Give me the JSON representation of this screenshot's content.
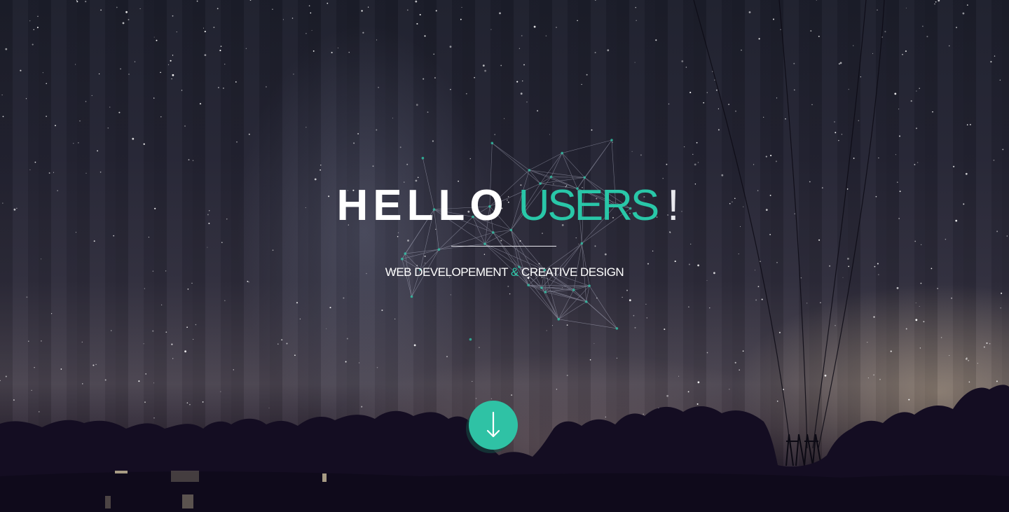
{
  "hero": {
    "title_word_1": "HELLO",
    "title_word_2": "USERS",
    "title_punct": "!",
    "subtitle_part_1": "WEB DEVELOPEMENT ",
    "subtitle_amp": "&",
    "subtitle_part_2": " CREATIVE DESIGN",
    "scroll_icon": "arrow-down-icon"
  },
  "colors": {
    "accent": "#2fc2a5",
    "accent_text": "#29c7a8",
    "text": "#ffffff",
    "sky_dark": "#1d1f2c",
    "ground": "#120d1e"
  }
}
